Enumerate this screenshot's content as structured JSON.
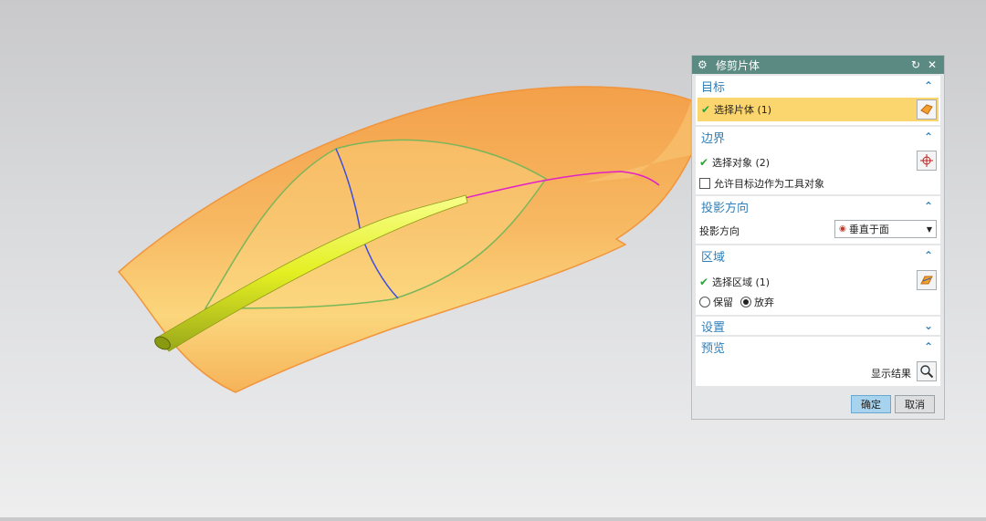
{
  "dialog": {
    "title": "修剪片体",
    "sections": {
      "target": {
        "heading": "目标",
        "select_label": "选择片体 (1)"
      },
      "boundary": {
        "heading": "边界",
        "select_label": "选择对象 (2)",
        "checkbox_label": "允许目标边作为工具对象"
      },
      "projection": {
        "heading": "投影方向",
        "field_label": "投影方向",
        "selected_value": "垂直于面"
      },
      "region": {
        "heading": "区域",
        "select_label": "选择区域 (1)",
        "keep_label": "保留",
        "discard_label": "放弃",
        "selected": "discard"
      },
      "settings": {
        "heading": "设置"
      },
      "preview": {
        "heading": "预览",
        "show_result_label": "显示结果"
      }
    },
    "buttons": {
      "ok_label": "确定",
      "cancel_label": "取消"
    }
  },
  "colors": {
    "title_bar": "#5a8a82",
    "section_heading": "#2f7fb8",
    "highlight_row": "#fbd56e",
    "ok_button": "#a8d3ee",
    "surface": "#f6a84a",
    "tube": "#e6f03a",
    "curve_green": "#7ab65a",
    "curve_blue": "#3d4fe0",
    "curve_magenta": "#e020c8"
  },
  "icons": [
    "gear-icon",
    "reset-icon",
    "close-icon",
    "chevron-up-icon",
    "chevron-down-icon",
    "checkmark-icon",
    "sheet-body-icon",
    "crosshair-icon",
    "region-icon",
    "magnifier-icon",
    "projection-icon"
  ]
}
